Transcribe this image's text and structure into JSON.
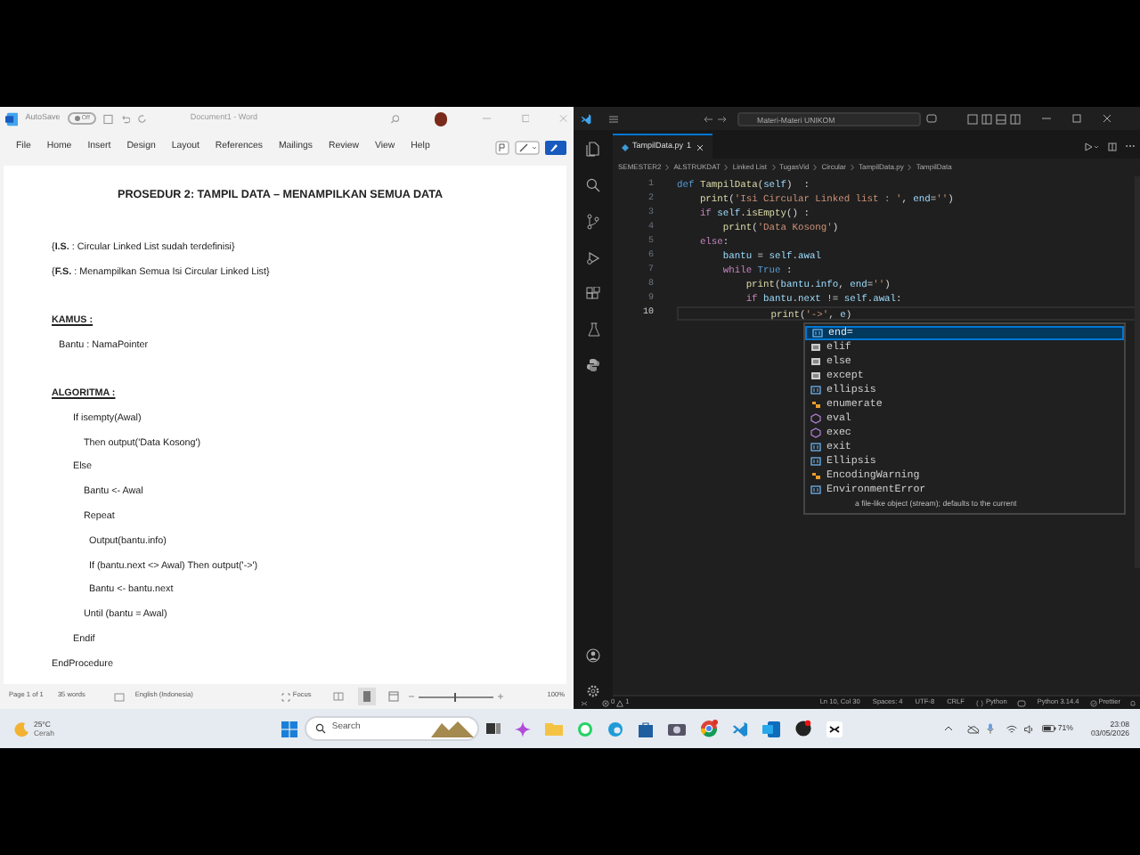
{
  "word": {
    "title_bar": {
      "autosave": "AutoSave",
      "toggle": "Off",
      "document": "Document1 - Word"
    },
    "menu": [
      "File",
      "Home",
      "Insert",
      "Design",
      "Layout",
      "References",
      "Mailings",
      "Review",
      "View",
      "Help"
    ],
    "document": {
      "title": "PROSEDUR 2: TAMPIL DATA – MENAMPILKAN SEMUA DATA",
      "conditions": [
        "{**I.S.** : Circular Linked List sudah terdefinisi}",
        "{**F.S.** : Menampilkan Semua Isi Circular Linked List}"
      ],
      "kamus": {
        "heading": "KAMUS :",
        "entries": [
          "Bantu : NamaPointer"
        ]
      },
      "algoritma": {
        "heading": "ALGORITMA :",
        "steps": [
          {
            "text": "If isempty(Awal)",
            "children": [
              {
                "text": "Then output('Data Kosong')"
              }
            ]
          },
          {
            "text": "Else",
            "children": [
              {
                "text": "Bantu  <- Awal"
              },
              {
                "text": "Repeat",
                "children": [
                  {
                    "text": "Output(bantu.info)"
                  },
                  {
                    "text": "If (bantu.next <> Awal) Then output('->')"
                  },
                  {
                    "text": "Bantu <- bantu.next"
                  }
                ]
              },
              {
                "text": "Until (bantu = Awal)"
              }
            ]
          },
          {
            "text": "Endif"
          },
          {
            "text": "EndProcedure",
            "top": true
          }
        ]
      }
    },
    "status_bar": {
      "page": "Page 1 of 1",
      "words": "35 words",
      "language": "English (Indonesia)",
      "focus": "Focus",
      "zoom": "100%",
      "zoom_level": {
        "level": 0.5
      }
    }
  },
  "vscode": {
    "title": "Materi-Materi UNIKOM",
    "tab": {
      "label": "TampilData.py",
      "problems": "1"
    },
    "breadcrumbs": [
      "SEMESTER2",
      "ALSTRUKDAT",
      "Linked List",
      "TugasVid",
      "Circular",
      "TampilData.py",
      "TampilData"
    ],
    "lines": [
      {
        "number": "1",
        "current": false,
        "tokens": [
          {
            "kind": "kw",
            "text": "def "
          },
          {
            "kind": "fn",
            "text": "TampilData"
          },
          {
            "kind": "p",
            "text": "("
          },
          {
            "kind": "var",
            "text": "self"
          },
          {
            "kind": "p",
            "text": ")  :"
          }
        ]
      },
      {
        "number": "2",
        "current": false,
        "tokens": [
          {
            "kind": "fn",
            "text": "    print"
          },
          {
            "kind": "p",
            "text": "("
          },
          {
            "kind": "str",
            "text": "'Isi Circular Linked list : '"
          },
          {
            "kind": "p",
            "text": ", "
          },
          {
            "kind": "var",
            "text": "end"
          },
          {
            "kind": "p",
            "text": "="
          },
          {
            "kind": "str",
            "text": "''"
          },
          {
            "kind": "p",
            "text": ")"
          }
        ]
      },
      {
        "number": "3",
        "current": false,
        "tokens": [
          {
            "kind": "ctl",
            "text": "    if "
          },
          {
            "kind": "var",
            "text": "self"
          },
          {
            "kind": "p",
            "text": "."
          },
          {
            "kind": "fn",
            "text": "isEmpty"
          },
          {
            "kind": "p",
            "text": "() :"
          }
        ]
      },
      {
        "number": "4",
        "current": false,
        "tokens": [
          {
            "kind": "fn",
            "text": "        print"
          },
          {
            "kind": "p",
            "text": "("
          },
          {
            "kind": "str",
            "text": "'Data Kosong'"
          },
          {
            "kind": "p",
            "text": ")"
          }
        ]
      },
      {
        "number": "5",
        "current": false,
        "tokens": [
          {
            "kind": "ctl",
            "text": "    else"
          },
          {
            "kind": "p",
            "text": ":"
          }
        ]
      },
      {
        "number": "6",
        "current": false,
        "tokens": [
          {
            "kind": "var",
            "text": "        bantu"
          },
          {
            "kind": "p",
            "text": " = "
          },
          {
            "kind": "var",
            "text": "self"
          },
          {
            "kind": "p",
            "text": "."
          },
          {
            "kind": "var",
            "text": "awal"
          }
        ]
      },
      {
        "number": "7",
        "current": false,
        "tokens": [
          {
            "kind": "ctl",
            "text": "        while "
          },
          {
            "kind": "kw",
            "text": "True"
          },
          {
            "kind": "p",
            "text": " :"
          }
        ]
      },
      {
        "number": "8",
        "current": false,
        "tokens": [
          {
            "kind": "fn",
            "text": "            print"
          },
          {
            "kind": "p",
            "text": "("
          },
          {
            "kind": "var",
            "text": "bantu"
          },
          {
            "kind": "p",
            "text": "."
          },
          {
            "kind": "var",
            "text": "info"
          },
          {
            "kind": "p",
            "text": ", "
          },
          {
            "kind": "var",
            "text": "end"
          },
          {
            "kind": "p",
            "text": "="
          },
          {
            "kind": "str",
            "text": "''"
          },
          {
            "kind": "p",
            "text": ")"
          }
        ]
      },
      {
        "number": "9",
        "current": false,
        "tokens": [
          {
            "kind": "ctl",
            "text": "            if "
          },
          {
            "kind": "var",
            "text": "bantu"
          },
          {
            "kind": "p",
            "text": "."
          },
          {
            "kind": "var",
            "text": "next"
          },
          {
            "kind": "p",
            "text": " != "
          },
          {
            "kind": "var",
            "text": "self"
          },
          {
            "kind": "p",
            "text": "."
          },
          {
            "kind": "var",
            "text": "awal"
          },
          {
            "kind": "p",
            "text": ":"
          }
        ]
      },
      {
        "number": "10",
        "current": true,
        "tokens": [
          {
            "kind": "fn",
            "text": "                print"
          },
          {
            "kind": "p",
            "text": "("
          },
          {
            "kind": "str",
            "text": "'->'"
          },
          {
            "kind": "p",
            "text": ", "
          },
          {
            "kind": "var",
            "text": "e"
          },
          {
            "kind": "p",
            "text": ")"
          }
        ]
      }
    ],
    "suggestions": [
      {
        "kind": "variable",
        "text": "end=",
        "selected": true
      },
      {
        "kind": "keyword",
        "text": "elif",
        "selected": false
      },
      {
        "kind": "keyword",
        "text": "else",
        "selected": false
      },
      {
        "kind": "keyword",
        "text": "except",
        "selected": false
      },
      {
        "kind": "variable",
        "text": "ellipsis",
        "selected": false
      },
      {
        "kind": "class",
        "text": "enumerate",
        "selected": false
      },
      {
        "kind": "function",
        "text": "eval",
        "selected": false
      },
      {
        "kind": "function",
        "text": "exec",
        "selected": false
      },
      {
        "kind": "variable",
        "text": "exit",
        "selected": false
      },
      {
        "kind": "variable",
        "text": "Ellipsis",
        "selected": false
      },
      {
        "kind": "class",
        "text": "EncodingWarning",
        "selected": false
      },
      {
        "kind": "variable",
        "text": "EnvironmentError",
        "selected": false
      }
    ],
    "suggestion_detail": "a file-like object (stream); defaults to the current",
    "status_bar": {
      "errors": "0",
      "warnings": "1",
      "position": "Ln 10, Col 30",
      "spaces": "Spaces: 4",
      "encoding": "UTF-8",
      "eol": "CRLF",
      "language": "Python",
      "interpreter": "Python 3.14.4",
      "formatter": "Prettier"
    }
  },
  "taskbar": {
    "weather": {
      "temperature": "25°C",
      "condition": "Cerah"
    },
    "search": {
      "placeholder": "Search"
    },
    "battery": "71%",
    "time": "23:08",
    "date": "03/05/2026"
  }
}
